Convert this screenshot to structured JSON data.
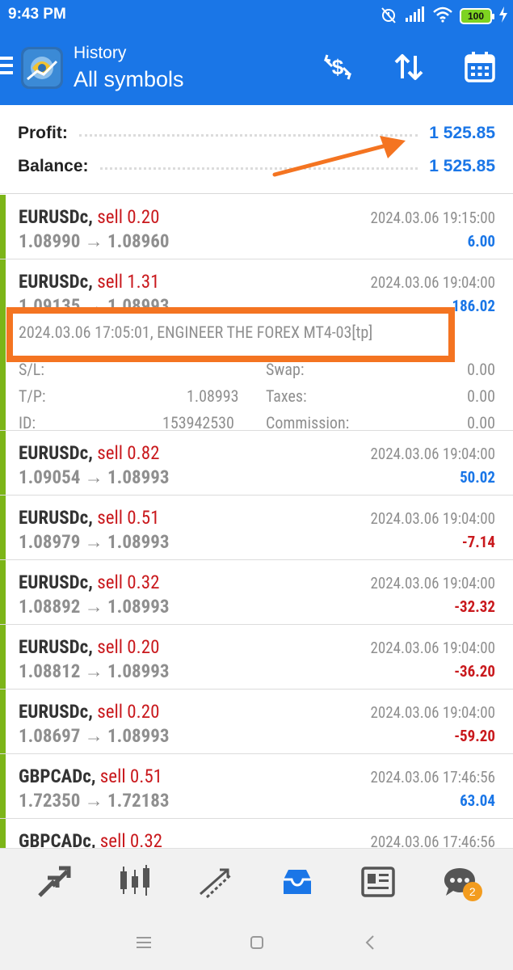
{
  "status_bar": {
    "time": "9:43 PM",
    "battery": "100"
  },
  "app_bar": {
    "subtitle": "History",
    "title": "All symbols"
  },
  "summary": {
    "profit_label": "Profit:",
    "profit_value": "1 525.85",
    "balance_label": "Balance:",
    "balance_value": "1 525.85"
  },
  "deals": [
    {
      "symbol": "EURUSDc,",
      "type": "sell 0.20",
      "prices": "1.08990 → 1.08960",
      "time": "2024.03.06 19:15:00",
      "profit": "6.00",
      "negative": false
    },
    {
      "symbol": "EURUSDc,",
      "type": "sell 1.31",
      "prices": "1.09135 → 1.08993",
      "time": "2024.03.06 19:04:00",
      "profit": "186.02",
      "negative": false,
      "details": {
        "comment": "2024.03.06 17:05:01, ENGINEER THE FOREX MT4-03[tp]",
        "sl_label": "S/L:",
        "sl_value": "",
        "swap_label": "Swap:",
        "swap_value": "0.00",
        "tp_label": "T/P:",
        "tp_value": "1.08993",
        "taxes_label": "Taxes:",
        "taxes_value": "0.00",
        "id_label": "ID:",
        "id_value": "153942530",
        "commission_label": "Commission:",
        "commission_value": "0.00"
      }
    },
    {
      "symbol": "EURUSDc,",
      "type": "sell 0.82",
      "prices": "1.09054 → 1.08993",
      "time": "2024.03.06 19:04:00",
      "profit": "50.02",
      "negative": false
    },
    {
      "symbol": "EURUSDc,",
      "type": "sell 0.51",
      "prices": "1.08979 → 1.08993",
      "time": "2024.03.06 19:04:00",
      "profit": "-7.14",
      "negative": true
    },
    {
      "symbol": "EURUSDc,",
      "type": "sell 0.32",
      "prices": "1.08892 → 1.08993",
      "time": "2024.03.06 19:04:00",
      "profit": "-32.32",
      "negative": true
    },
    {
      "symbol": "EURUSDc,",
      "type": "sell 0.20",
      "prices": "1.08812 → 1.08993",
      "time": "2024.03.06 19:04:00",
      "profit": "-36.20",
      "negative": true
    },
    {
      "symbol": "EURUSDc,",
      "type": "sell 0.20",
      "prices": "1.08697 → 1.08993",
      "time": "2024.03.06 19:04:00",
      "profit": "-59.20",
      "negative": true
    },
    {
      "symbol": "GBPCADc,",
      "type": "sell 0.51",
      "prices": "1.72350 → 1.72183",
      "time": "2024.03.06 17:46:56",
      "profit": "63.04",
      "negative": false
    },
    {
      "symbol": "GBPCADc,",
      "type": "sell 0.32",
      "prices": "",
      "time": "2024.03.06 17:46:56",
      "profit": "",
      "negative": false
    }
  ],
  "bottom_nav": {
    "chat_badge": "2"
  },
  "colors": {
    "accent": "#1a76e7",
    "sell": "#c9191d",
    "positive": "#1a76e7",
    "negative": "#c9191d",
    "annotation": "#f47421",
    "row_marker": "#7cb518"
  }
}
